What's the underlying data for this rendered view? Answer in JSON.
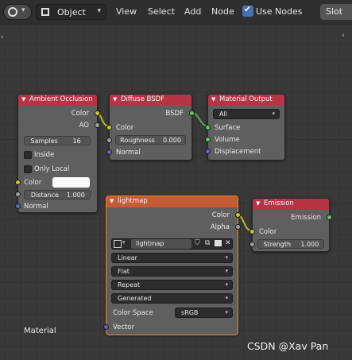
{
  "header": {
    "editor_icon": "node-editor-icon",
    "object_dropdown": "Object",
    "menus": [
      "View",
      "Select",
      "Add",
      "Node"
    ],
    "use_nodes_label": "Use Nodes",
    "use_nodes_checked": true,
    "slot_label": "Slot"
  },
  "canvas": {
    "material_label": "Material",
    "watermark": "CSDN @Xav Pan"
  },
  "nodes": {
    "ambient_occlusion": {
      "title": "Ambient Occlusion",
      "out_color": "Color",
      "out_ao": "AO",
      "samples_label": "Samples",
      "samples_value": "16",
      "inside_label": "Inside",
      "inside_checked": false,
      "only_local_label": "Only Local",
      "only_local_checked": false,
      "color_label": "Color",
      "color_value": "#ffffff",
      "distance_label": "Distance",
      "distance_value": "1.000",
      "normal_label": "Normal"
    },
    "diffuse_bsdf": {
      "title": "Diffuse BSDF",
      "out_bsdf": "BSDF",
      "color_label": "Color",
      "roughness_label": "Roughness",
      "roughness_value": "0.000",
      "normal_label": "Normal"
    },
    "material_output": {
      "title": "Material Output",
      "target": "All",
      "surface_label": "Surface",
      "volume_label": "Volume",
      "displacement_label": "Displacement"
    },
    "lightmap": {
      "title": "lightmap",
      "out_color": "Color",
      "out_alpha": "Alpha",
      "image_name": "lightmap",
      "interpolation": "Linear",
      "projection": "Flat",
      "extension": "Repeat",
      "source": "Generated",
      "color_space_label": "Color Space",
      "color_space_value": "sRGB",
      "vector_label": "Vector"
    },
    "emission": {
      "title": "Emission",
      "out_emission": "Emission",
      "color_label": "Color",
      "strength_label": "Strength",
      "strength_value": "1.000"
    }
  },
  "colors": {
    "shader_header": "#b53545",
    "texture_header": "#c55b34",
    "socket_color": "#c7c729",
    "socket_float": "#a1a1a1",
    "socket_vector": "#6363c7",
    "socket_shader": "#63c763",
    "selected_outline": "#e8892d",
    "accent": "#4772b3"
  }
}
